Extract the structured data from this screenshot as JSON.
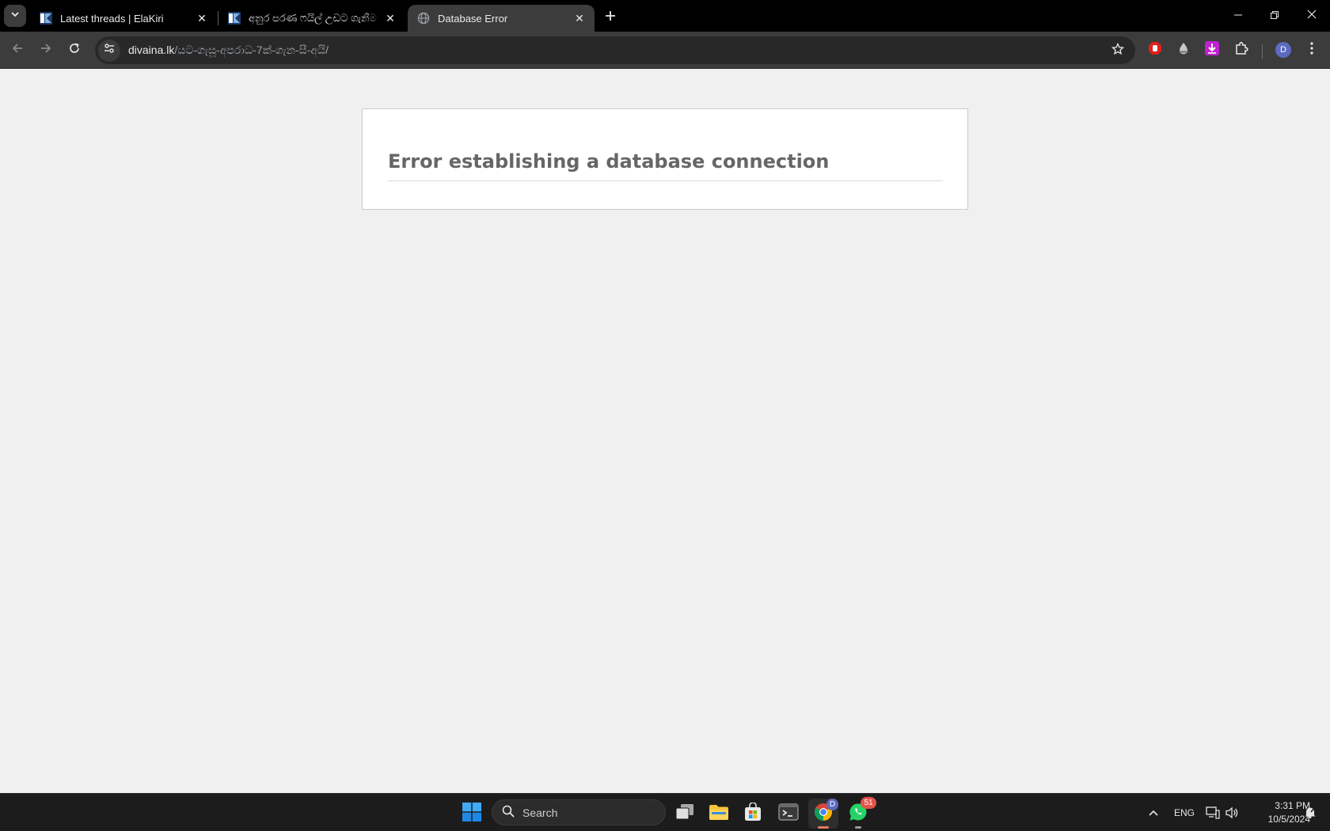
{
  "browser": {
    "tabs": [
      {
        "title": "Latest threads | ElaKiri",
        "favicon": "elakiri-icon",
        "active": false
      },
      {
        "title": "අනුර පරණ ෆයිල් උඩට ගැනීම",
        "favicon": "elakiri-icon",
        "active": false
      },
      {
        "title": "Database Error",
        "favicon": "globe-icon",
        "active": true
      }
    ],
    "url_host": "divaina.lk",
    "url_path": "/යට-ගැසූ-අපරාධ-7ක්-ගැන-සී-අයි/",
    "profile_initial": "D"
  },
  "page": {
    "error_title": "Error establishing a database connection"
  },
  "taskbar": {
    "search_label": "Search",
    "chrome_badge": "D",
    "whatsapp_badge": "51",
    "language": "ENG",
    "time": "3:31 PM",
    "date": "10/5/2024"
  },
  "colors": {
    "page_background": "#f0f0f0",
    "error_text": "#666666",
    "tab_active": "#3c3c3c",
    "taskbar": "#1c1c1c",
    "whatsapp": "#25d366",
    "badge_red": "#e5534b"
  }
}
